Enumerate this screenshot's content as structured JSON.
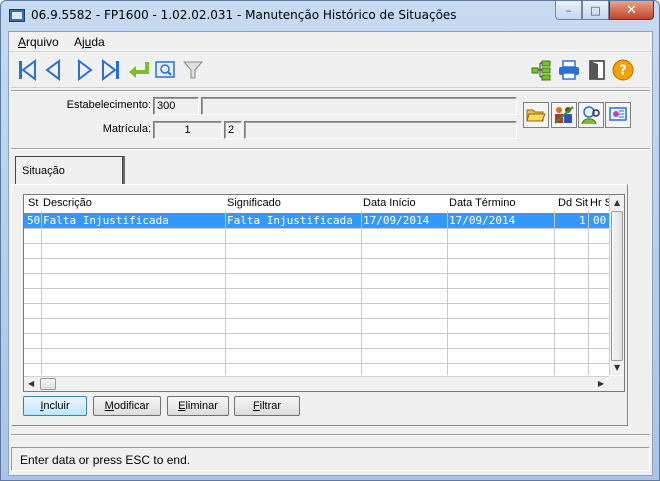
{
  "window": {
    "title": "06.9.5582 - FP1600 - 1.02.02.031 - Manutenção Histórico de Situações",
    "minimize": "–",
    "maximize": "□",
    "close": "✕"
  },
  "menu": {
    "arquivo_pre": "",
    "arquivo_u": "A",
    "arquivo_post": "rquivo",
    "ajuda_pre": "Aj",
    "ajuda_u": "u",
    "ajuda_post": "da"
  },
  "toolbar": {
    "icons": [
      "first-record-icon",
      "previous-record-icon",
      "next-record-icon",
      "last-record-icon",
      "goto-icon",
      "search-icon",
      "filter-icon",
      "tree-icon",
      "print-icon",
      "exit-icon",
      "help-icon"
    ],
    "help_glyph": "?"
  },
  "form": {
    "estabelecimento_label": "Estabelecimento:",
    "estabelecimento_value": "300",
    "estabelecimento_desc": "",
    "matricula_label": "Matrícula:",
    "matricula_value": "1",
    "matricula_digit": "2",
    "matricula_name": ""
  },
  "tabs": [
    {
      "label": "Situação"
    }
  ],
  "grid": {
    "columns": [
      "St",
      "Descrição",
      "Significado",
      "Data Início",
      "Data Término",
      "Dd Sit",
      "Hr S"
    ],
    "rows": [
      {
        "st": "50",
        "descricao": "Falta Injustificada",
        "significado": "Falta Injustificada",
        "data_inicio": "17/09/2014",
        "data_termino": "17/09/2014",
        "dd_sit": "1",
        "hr_s": "00"
      }
    ]
  },
  "actions": {
    "incluir_pre": "",
    "incluir_u": "I",
    "incluir_post": "ncluir",
    "modificar_pre": "",
    "modificar_u": "M",
    "modificar_post": "odificar",
    "eliminar_pre": "",
    "eliminar_u": "E",
    "eliminar_post": "liminar",
    "filtrar_pre": "",
    "filtrar_u": "F",
    "filtrar_post": "iltrar"
  },
  "status": {
    "text": "Enter data or press ESC to end."
  },
  "colors": {
    "selection": "#3399ff",
    "nav_arrows": "#2a6fd6",
    "enter_arrow": "#7bbf2a",
    "help": "#f5a000"
  }
}
